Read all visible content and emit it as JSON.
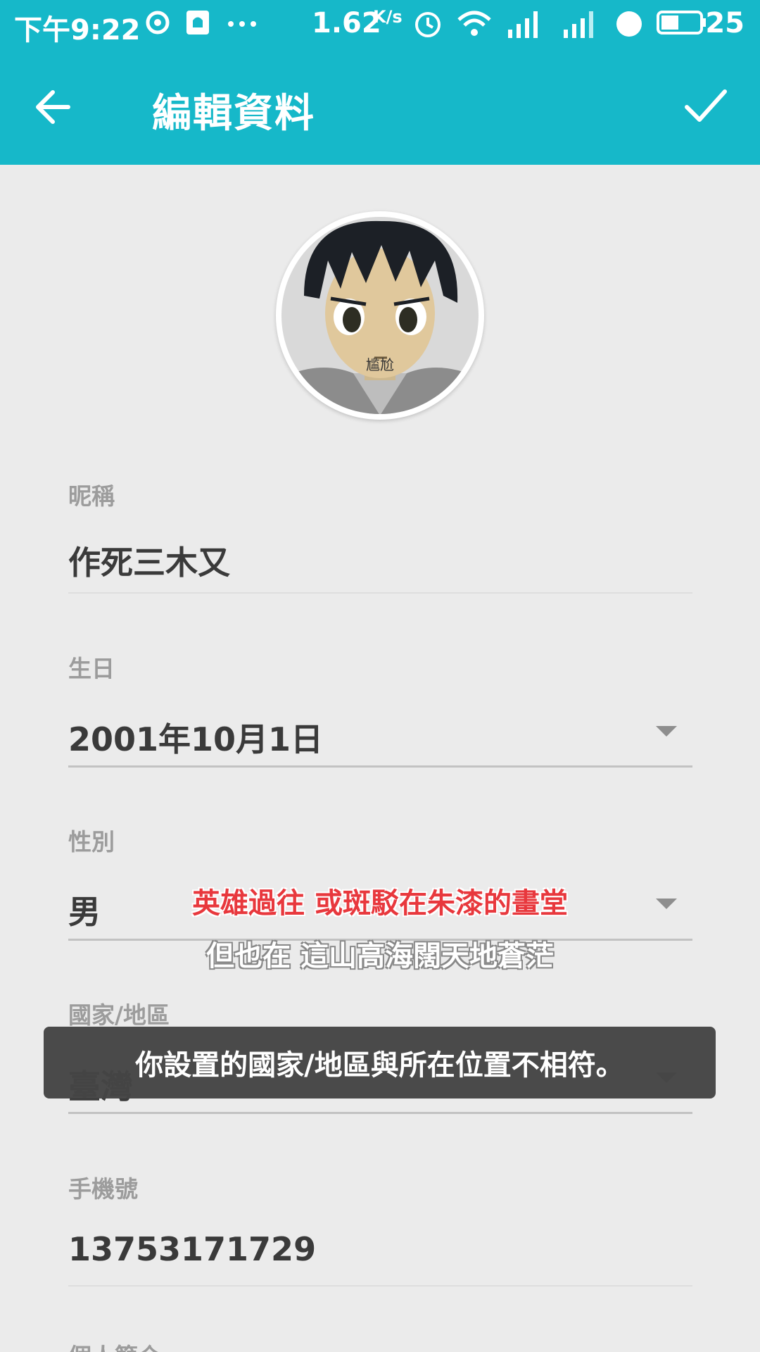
{
  "status_bar": {
    "time": "下午9:22",
    "network_speed": "1.62",
    "network_unit": "K/s",
    "battery": "25"
  },
  "app_bar": {
    "title": "編輯資料"
  },
  "form": {
    "nickname": {
      "label": "昵稱",
      "value": "作死三木又"
    },
    "birthday": {
      "label": "生日",
      "value": "2001年10月1日"
    },
    "gender": {
      "label": "性別",
      "value": "男"
    },
    "region": {
      "label": "國家/地區",
      "value": "臺灣"
    },
    "phone": {
      "label": "手機號",
      "value": "13753171729"
    },
    "bio": {
      "label": "個人簡介"
    }
  },
  "avatar": {
    "caption": "尴尬"
  },
  "overlay": {
    "subtitle_red": "英雄過往  或斑駁在朱漆的畫堂",
    "subtitle_white": "但也在  這山高海闊天地蒼茫"
  },
  "toast": {
    "message": "你設置的國家/地區與所在位置不相符。"
  },
  "colors": {
    "primary": "#16b8c9",
    "background": "#ebebeb",
    "subtitle_red": "#e8383d"
  },
  "icons": [
    "back-arrow-icon",
    "check-icon",
    "dropdown-arrow-icon"
  ]
}
